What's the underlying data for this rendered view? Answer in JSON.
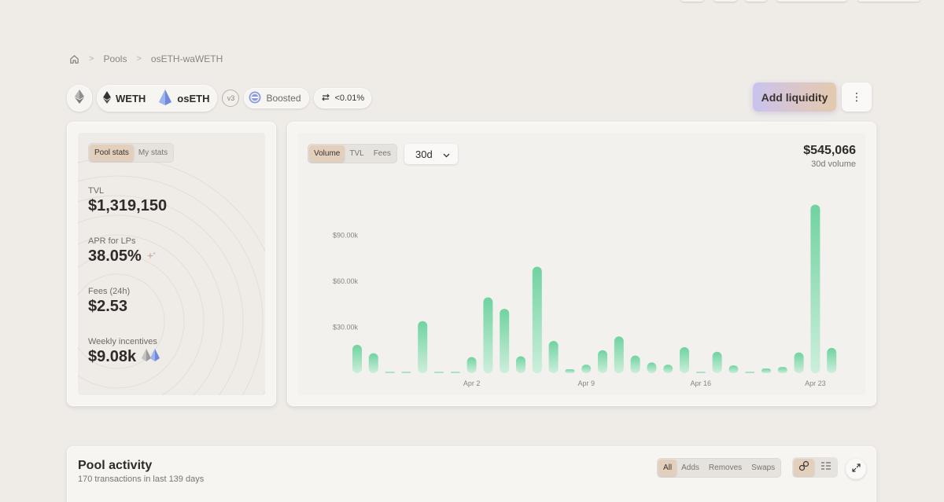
{
  "breadcrumb": {
    "items": [
      "Pools",
      "osETH-waWETH"
    ]
  },
  "header": {
    "tokens": [
      {
        "symbol": "WETH",
        "icon": "eth-icon"
      },
      {
        "symbol": "osETH",
        "icon": "oseth-icon"
      }
    ],
    "version": "v3",
    "boosted_label": "Boosted",
    "fee_label": "<0.01%",
    "add_liquidity_label": "Add liquidity",
    "more_label": "⋮"
  },
  "stats": {
    "tabs": [
      "Pool stats",
      "My stats"
    ],
    "items": [
      {
        "label": "TVL",
        "value": "$1,319,150"
      },
      {
        "label": "APR for LPs",
        "value": "38.05%"
      },
      {
        "label": "Fees (24h)",
        "value": "$2.53"
      },
      {
        "label": "Weekly incentives",
        "value": "$9.08k"
      }
    ]
  },
  "chart": {
    "tabs": [
      "Volume",
      "TVL",
      "Fees"
    ],
    "period": "30d",
    "total_value": "$545,066",
    "total_label": "30d volume"
  },
  "chart_data": {
    "type": "bar",
    "ylim": [
      0,
      120000
    ],
    "yticks": [
      30000,
      60000,
      90000
    ],
    "ytick_labels": [
      "$30.00k",
      "$60.00k",
      "$90.00k"
    ],
    "xtick_labels": [
      {
        "label": "Apr 2",
        "index": 7
      },
      {
        "label": "Apr 9",
        "index": 14
      },
      {
        "label": "Apr 16",
        "index": 21
      },
      {
        "label": "Apr 23",
        "index": 28
      }
    ],
    "values": [
      18500,
      13000,
      0,
      0,
      34000,
      600,
      500,
      10500,
      49500,
      42000,
      11000,
      69500,
      21000,
      2500,
      5500,
      15000,
      24000,
      11500,
      7000,
      5500,
      17000,
      600,
      14000,
      5000,
      500,
      3000,
      4000,
      13500,
      110000,
      16500
    ],
    "color": "#6fd3a0"
  },
  "activity": {
    "title": "Pool activity",
    "subtitle": "170 transactions in last 139 days",
    "filters": [
      "All",
      "Adds",
      "Removes",
      "Swaps"
    ]
  }
}
